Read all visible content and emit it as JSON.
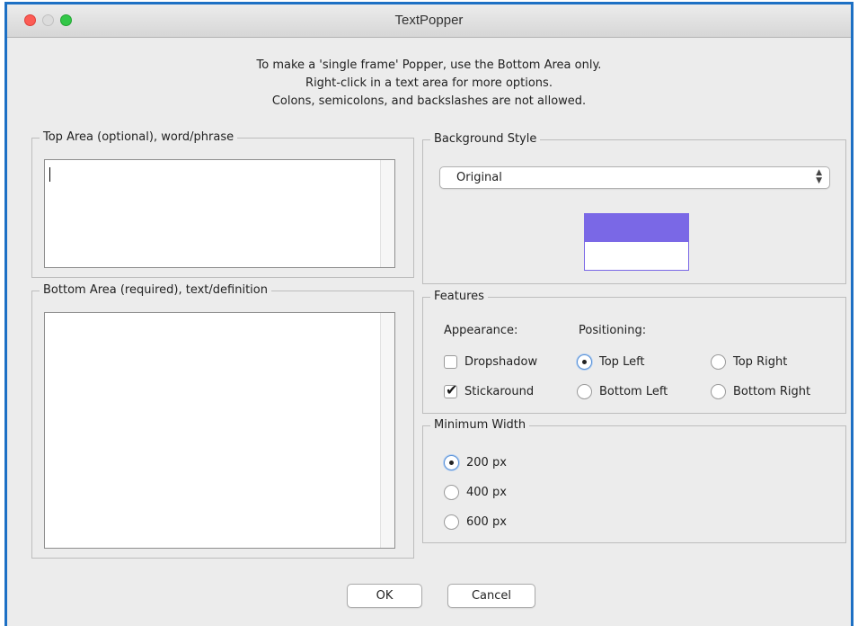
{
  "window": {
    "title": "TextPopper"
  },
  "instructions": [
    "To make a 'single frame' Popper, use the Bottom Area only.",
    "Right-click in a text area for more options.",
    "Colons, semicolons, and backslashes are not allowed."
  ],
  "top_area": {
    "legend": "Top Area (optional), word/phrase",
    "value": ""
  },
  "bottom_area": {
    "legend": "Bottom Area (required), text/definition",
    "value": ""
  },
  "background_style": {
    "legend": "Background Style",
    "selected": "Original",
    "preview_colors": {
      "top": "#7a68e6",
      "bottom": "#ffffff"
    }
  },
  "features": {
    "legend": "Features",
    "appearance_label": "Appearance:",
    "positioning_label": "Positioning:",
    "dropshadow": {
      "label": "Dropshadow",
      "checked": false
    },
    "stickaround": {
      "label": "Stickaround",
      "checked": true
    },
    "positions": {
      "top_left": {
        "label": "Top Left",
        "selected": true
      },
      "top_right": {
        "label": "Top Right",
        "selected": false
      },
      "bottom_left": {
        "label": "Bottom Left",
        "selected": false
      },
      "bottom_right": {
        "label": "Bottom Right",
        "selected": false
      }
    }
  },
  "minimum_width": {
    "legend": "Minimum Width",
    "options": [
      {
        "label": "200 px",
        "selected": true
      },
      {
        "label": "400 px",
        "selected": false
      },
      {
        "label": "600 px",
        "selected": false
      }
    ]
  },
  "buttons": {
    "ok": "OK",
    "cancel": "Cancel"
  },
  "colors": {
    "window_border": "#1d70c4",
    "selected_radio_ring": "#5a91d6"
  }
}
